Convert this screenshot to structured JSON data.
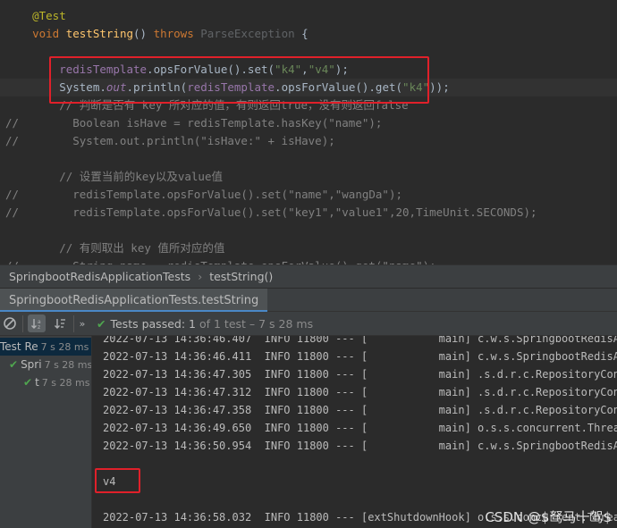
{
  "editor": {
    "lines": [
      {
        "gutter": "",
        "segments": [
          {
            "cls": "ann",
            "text": "    @Test"
          }
        ]
      },
      {
        "gutter": "",
        "segments": [
          {
            "cls": "kw",
            "text": "    void "
          },
          {
            "cls": "fn",
            "text": "testString"
          },
          {
            "cls": "plain",
            "text": "() "
          },
          {
            "cls": "kw",
            "text": "throws "
          },
          {
            "cls": "dim",
            "text": "ParseException"
          },
          {
            "cls": "plain",
            "text": " {"
          }
        ]
      },
      {
        "gutter": "",
        "segments": []
      },
      {
        "gutter": "",
        "segments": [
          {
            "cls": "field",
            "text": "        redisTemplate"
          },
          {
            "cls": "plain",
            "text": ".opsForValue().set("
          },
          {
            "cls": "str",
            "text": "\"k4\""
          },
          {
            "cls": "plain",
            "text": ","
          },
          {
            "cls": "str",
            "text": "\"v4\""
          },
          {
            "cls": "plain",
            "text": ");"
          }
        ]
      },
      {
        "gutter": "",
        "segments": [
          {
            "cls": "plain",
            "text": "        System."
          },
          {
            "cls": "ital",
            "text": "out"
          },
          {
            "cls": "plain",
            "text": ".println("
          },
          {
            "cls": "field",
            "text": "redisTemplate"
          },
          {
            "cls": "plain",
            "text": ".opsForValue().get("
          },
          {
            "cls": "str",
            "text": "\"k4\""
          },
          {
            "cls": "plain",
            "text": "));"
          }
        ]
      },
      {
        "gutter": "",
        "segments": [
          {
            "cls": "cmt",
            "text": "        // 判断是否有 key 所对应的值，有则返回true，没有则返回false"
          }
        ]
      },
      {
        "gutter": "//",
        "segments": [
          {
            "cls": "cmt",
            "text": "          Boolean isHave = redisTemplate.hasKey(\"name\");"
          }
        ]
      },
      {
        "gutter": "//",
        "segments": [
          {
            "cls": "cmt",
            "text": "          System.out.println(\"isHave:\" + isHave);"
          }
        ]
      },
      {
        "gutter": "",
        "segments": []
      },
      {
        "gutter": "",
        "segments": [
          {
            "cls": "cmt",
            "text": "        // 设置当前的key以及value值"
          }
        ]
      },
      {
        "gutter": "//",
        "segments": [
          {
            "cls": "cmt",
            "text": "          redisTemplate.opsForValue().set(\"name\",\"wangDa\");"
          }
        ]
      },
      {
        "gutter": "//",
        "segments": [
          {
            "cls": "cmt",
            "text": "          redisTemplate.opsForValue().set(\"key1\",\"value1\",20,TimeUnit.SECONDS);"
          }
        ]
      },
      {
        "gutter": "",
        "segments": []
      },
      {
        "gutter": "",
        "segments": [
          {
            "cls": "cmt",
            "text": "        // 有则取出 key 值所对应的值"
          }
        ]
      },
      {
        "gutter": "//",
        "segments": [
          {
            "cls": "cmt",
            "text": "          String name = redisTemplate.opsForValue().get(\"name\");"
          }
        ]
      }
    ]
  },
  "breadcrumb": {
    "class": "SpringbootRedisApplicationTests",
    "method": "testString()"
  },
  "run_tab": {
    "label": "SpringbootRedisApplicationTests.testString"
  },
  "toolbar": {
    "passed_label": "Tests passed:",
    "passed_count": "1",
    "passed_rest": "of 1 test – 7 s 28 ms"
  },
  "test_tree": [
    {
      "label": "Test Re",
      "time": "7 s 28 ms",
      "selected": true
    },
    {
      "label": "Spri",
      "time": "7 s 28 ms",
      "selected": false
    },
    {
      "label": "t",
      "time": "7 s 28 ms",
      "selected": false
    }
  ],
  "console": {
    "lines": [
      "2022-07-13 14:36:46.407  INFO 11800 --- [           main] c.w.s.SpringbootRedisApplicationTests",
      "2022-07-13 14:36:46.411  INFO 11800 --- [           main] c.w.s.SpringbootRedisApplicationTests",
      "2022-07-13 14:36:47.305  INFO 11800 --- [           main] .s.d.r.c.RepositoryConfigurationDelegate",
      "2022-07-13 14:36:47.312  INFO 11800 --- [           main] .s.d.r.c.RepositoryConfigurationDelegate",
      "2022-07-13 14:36:47.358  INFO 11800 --- [           main] .s.d.r.c.RepositoryConfigurationDelegate",
      "2022-07-13 14:36:49.650  INFO 11800 --- [           main] o.s.s.concurrent.ThreadPoolTaskExecutor",
      "2022-07-13 14:36:50.954  INFO 11800 --- [           main] c.w.s.SpringbootRedisApplicationTests",
      "",
      "v4",
      "",
      "2022-07-13 14:36:58.032  INFO 11800 --- [extShutdownHook] o.s.s.concurrent.ThreadPoolTaskExecutor"
    ]
  },
  "watermark": "CSDN @$驽马十驾$"
}
